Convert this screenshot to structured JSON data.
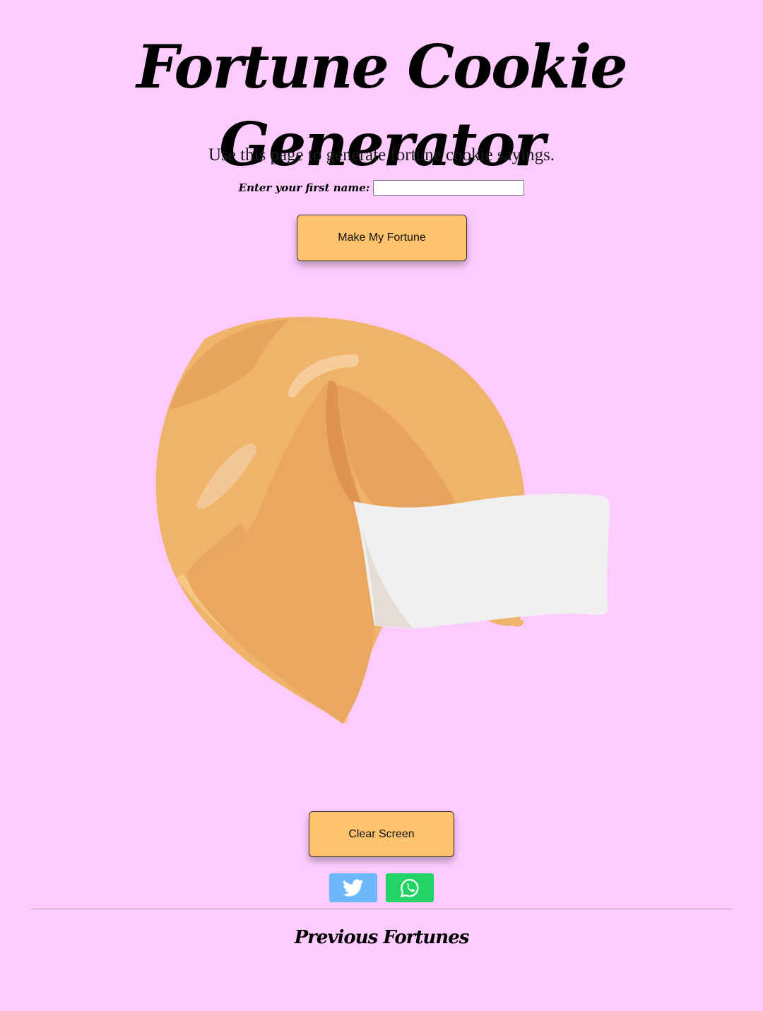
{
  "header": {
    "title": "Fortune Cookie Generator",
    "subtitle": "Use this page to generate fortune cookie sayings."
  },
  "form": {
    "name_label": "Enter your first name:",
    "name_value": "",
    "fortune_button": "Make My Fortune"
  },
  "cookie": {
    "icon": "fortune-cookie-illustration",
    "fortune_text": ""
  },
  "actions": {
    "clear_button": "Clear Screen"
  },
  "share": {
    "twitter_icon": "twitter-icon",
    "whatsapp_icon": "whatsapp-icon"
  },
  "previous": {
    "heading": "Previous Fortunes",
    "items": []
  },
  "colors": {
    "background": "#fdcbfd",
    "button": "#ffc36e",
    "twitter": "#6cb8fb",
    "whatsapp": "#23d366"
  }
}
